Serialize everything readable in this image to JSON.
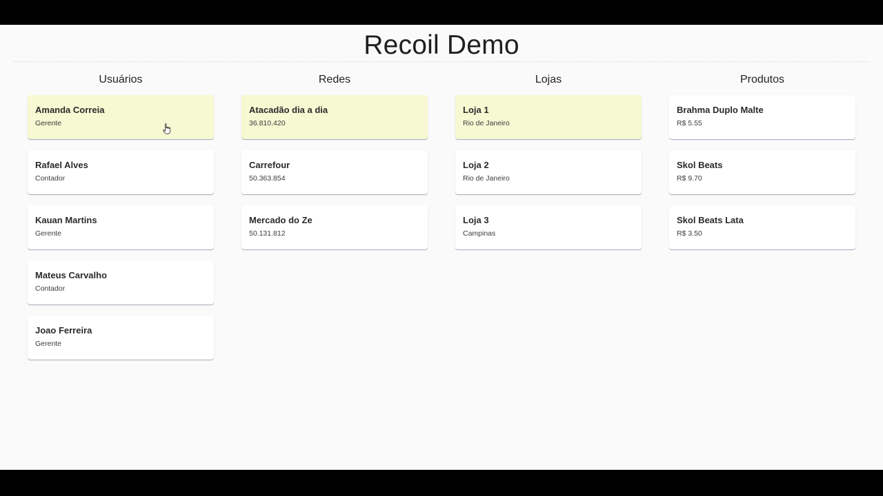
{
  "app": {
    "title": "Recoil Demo"
  },
  "columns": [
    {
      "title": "Usuários",
      "items": [
        {
          "title": "Amanda Correia",
          "subtitle": "Gerente",
          "selected": true
        },
        {
          "title": "Rafael Alves",
          "subtitle": "Contador",
          "selected": false
        },
        {
          "title": "Kauan Martins",
          "subtitle": "Gerente",
          "selected": false
        },
        {
          "title": "Mateus Carvalho",
          "subtitle": "Contador",
          "selected": false
        },
        {
          "title": "Joao Ferreira",
          "subtitle": "Gerente",
          "selected": false
        }
      ]
    },
    {
      "title": "Redes",
      "items": [
        {
          "title": "Atacadão dia a dia",
          "subtitle": "36.810.420",
          "selected": true
        },
        {
          "title": "Carrefour",
          "subtitle": "50.363.854",
          "selected": false
        },
        {
          "title": "Mercado do Ze",
          "subtitle": "50.131.812",
          "selected": false
        }
      ]
    },
    {
      "title": "Lojas",
      "items": [
        {
          "title": "Loja 1",
          "subtitle": "Rio de Janeiro",
          "selected": true
        },
        {
          "title": "Loja 2",
          "subtitle": "Rio de Janeiro",
          "selected": false
        },
        {
          "title": "Loja 3",
          "subtitle": "Campinas",
          "selected": false
        }
      ]
    },
    {
      "title": "Produtos",
      "items": [
        {
          "title": "Brahma Duplo Malte",
          "subtitle": "R$ 5.55",
          "selected": false
        },
        {
          "title": "Skol Beats",
          "subtitle": "R$ 9.70",
          "selected": false
        },
        {
          "title": "Skol Beats Lata",
          "subtitle": "R$ 3.50",
          "selected": false
        }
      ]
    }
  ],
  "colors": {
    "selected_card": "#f6f9d2",
    "card": "#ffffff",
    "background": "#fafafa"
  },
  "icons": {
    "cursor": "hand-pointer-icon"
  }
}
